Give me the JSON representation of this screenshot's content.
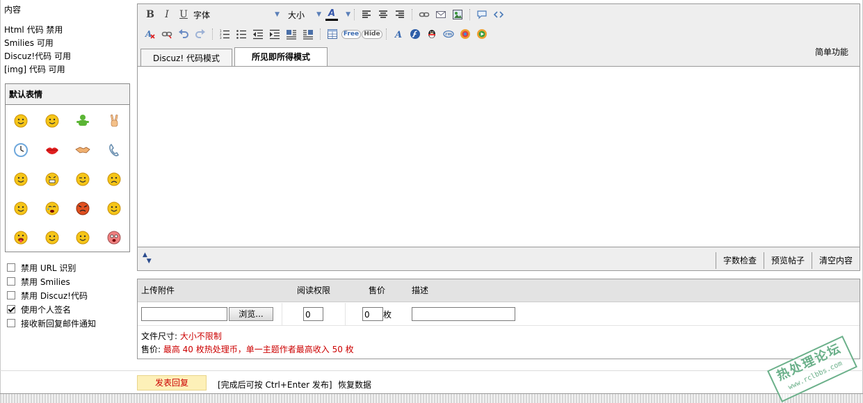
{
  "left": {
    "content_label": "内容",
    "status": [
      "Html 代码 禁用",
      "Smilies 可用",
      "Discuz!代码 可用",
      "[img] 代码 可用"
    ],
    "smilies_title": "默认表情",
    "smilies": [
      {
        "name": "smile",
        "color": "#f5c518"
      },
      {
        "name": "grin",
        "color": "#f5c518"
      },
      {
        "name": "green-person",
        "color": "#5bb535"
      },
      {
        "name": "victory-hand",
        "color": "#f3c089"
      },
      {
        "name": "clock",
        "color": "#6fa8dc"
      },
      {
        "name": "lips",
        "color": "#e02020"
      },
      {
        "name": "handshake",
        "color": "#f0b070"
      },
      {
        "name": "telephone",
        "color": "#6a8fb0"
      },
      {
        "name": "smile",
        "color": "#f5c518"
      },
      {
        "name": "angry",
        "color": "#f5c518"
      },
      {
        "name": "wink",
        "color": "#f5c518"
      },
      {
        "name": "sad",
        "color": "#f5c518"
      },
      {
        "name": "happy",
        "color": "#f5c518"
      },
      {
        "name": "cry",
        "color": "#f5c518"
      },
      {
        "name": "mad",
        "color": "#e05020"
      },
      {
        "name": "shy",
        "color": "#f5c518"
      },
      {
        "name": "tongue",
        "color": "#f5c518"
      },
      {
        "name": "sleepy",
        "color": "#f5c518"
      },
      {
        "name": "shocked",
        "color": "#f5c518"
      },
      {
        "name": "surprised",
        "color": "#f08080"
      }
    ],
    "options": [
      {
        "label": "禁用 URL 识别",
        "checked": false
      },
      {
        "label": "禁用 Smilies",
        "checked": false
      },
      {
        "label": "禁用 Discuz!代码",
        "checked": false
      },
      {
        "label": "使用个人签名",
        "checked": true
      },
      {
        "label": "接收新回复邮件通知",
        "checked": false
      }
    ]
  },
  "toolbar": {
    "bold": "B",
    "italic": "I",
    "underline": "U",
    "font_label": "字体",
    "size_label": "大小",
    "color_glyph": "A",
    "free_label": "Free",
    "hide_label": "Hide"
  },
  "editor": {
    "tab_code": "Discuz! 代码模式",
    "tab_wysiwyg": "所见即所得模式",
    "simple_mode": "简单功能",
    "word_count": "字数检查",
    "preview": "预览帖子",
    "clear": "清空内容"
  },
  "attachment": {
    "col_upload": "上传附件",
    "col_permission": "阅读权限",
    "col_price": "售价",
    "col_desc": "描述",
    "browse": "浏览...",
    "permission_value": "0",
    "price_value": "0",
    "price_unit": "枚",
    "size_label": "文件尺寸: ",
    "size_value": "大小不限制",
    "price_label": "售价: ",
    "price_note": "最高 40 枚热处理币，单一主题作者最高收入 50 枚"
  },
  "footer": {
    "submit": "发表回复",
    "hint": "[完成后可按 Ctrl+Enter 发布]",
    "restore": "恢复数据"
  },
  "stamp": {
    "main": "热处理论坛",
    "sub": "www.rclbbs.com"
  }
}
